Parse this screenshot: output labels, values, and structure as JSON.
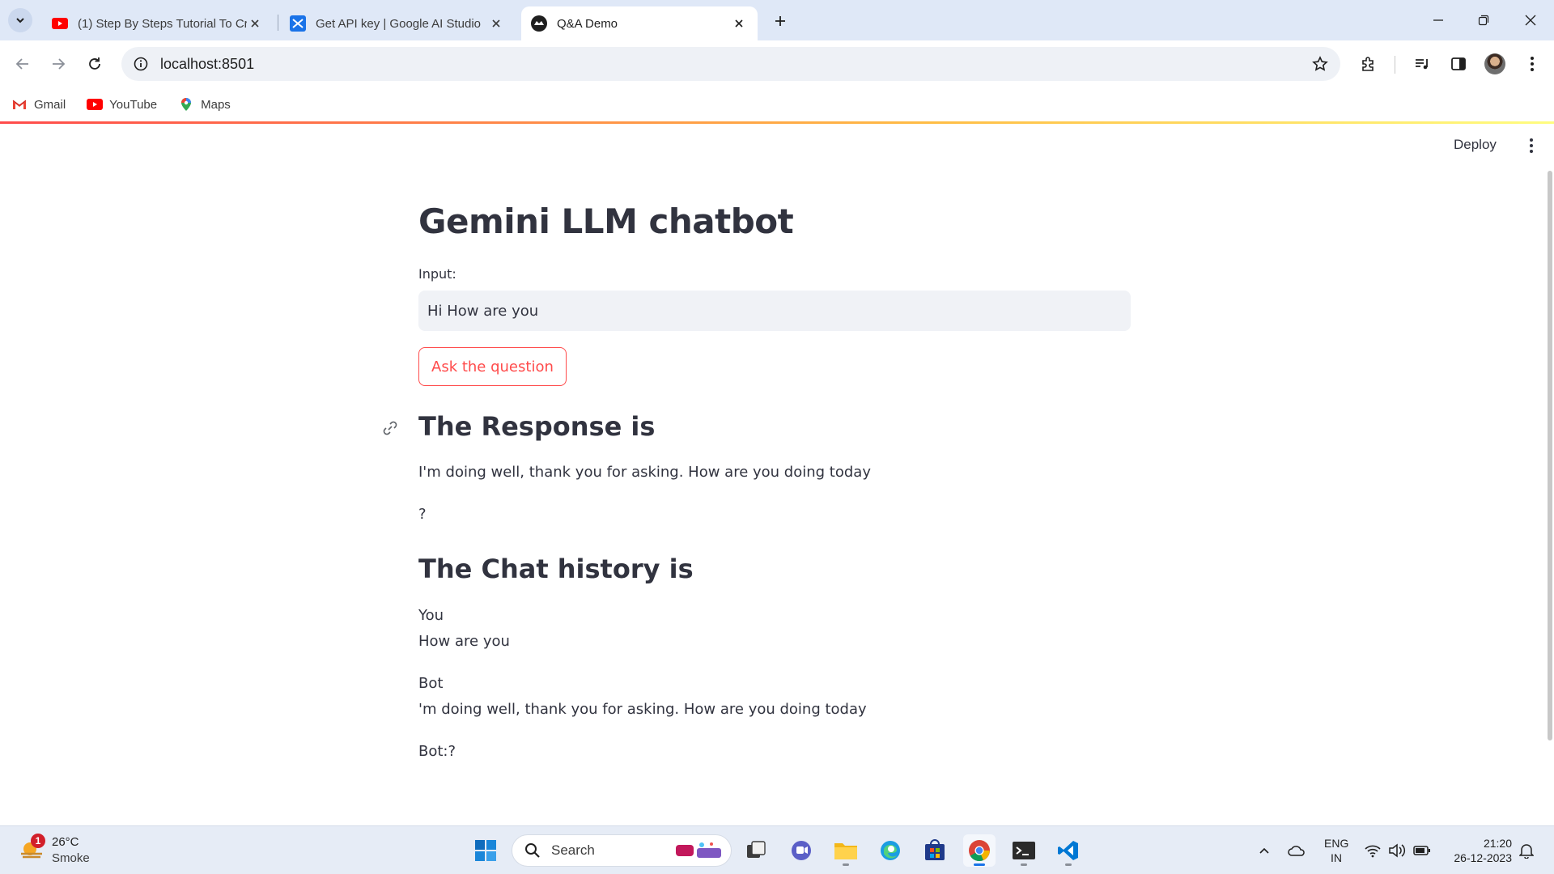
{
  "browser": {
    "tabs": [
      {
        "title": "(1) Step By Steps Tutorial To Create",
        "favicon": "youtube-icon",
        "active": false
      },
      {
        "title": "Get API key | Google AI Studio",
        "favicon": "ai-studio-icon",
        "active": false
      },
      {
        "title": "Q&A Demo",
        "favicon": "streamlit-icon",
        "active": true
      }
    ],
    "url": "localhost:8501",
    "bookmarks": [
      {
        "label": "Gmail",
        "icon": "gmail-icon"
      },
      {
        "label": "YouTube",
        "icon": "youtube-icon"
      },
      {
        "label": "Maps",
        "icon": "maps-icon"
      }
    ]
  },
  "app": {
    "deploy_label": "Deploy",
    "title": "Gemini LLM chatbot",
    "input_label": "Input:",
    "input_value": "Hi How are you",
    "ask_button": "Ask the question",
    "response_header": "The Response is",
    "response_lines": [
      "I'm doing well, thank you for asking. How are you doing today",
      "?"
    ],
    "history_header": "The Chat history is",
    "history": [
      {
        "role": "You",
        "text": "How are you"
      },
      {
        "role": "Bot",
        "text": "'m doing well, thank you for asking. How are you doing today"
      }
    ],
    "history_tail": "Bot:?"
  },
  "taskbar": {
    "weather": {
      "temp": "26°C",
      "condition": "Smoke",
      "badge": "1"
    },
    "search_label": "Search",
    "language": [
      "ENG",
      "IN"
    ],
    "time": "21:20",
    "date": "26-12-2023"
  },
  "colors": {
    "accent": "#ff4b4b",
    "tabstrip": "#dfe8f7",
    "input_bg": "#f0f2f6",
    "text": "#31333f"
  }
}
